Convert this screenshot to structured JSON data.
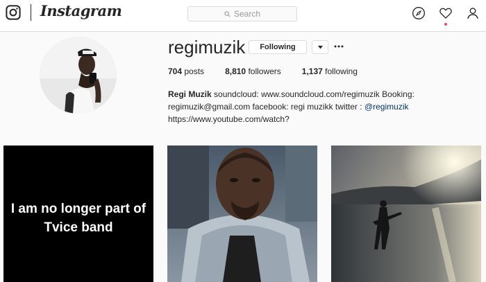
{
  "header": {
    "brand": "Instagram",
    "search_placeholder": "Search",
    "icons": [
      "instagram-camera-icon",
      "compass-icon",
      "heart-icon",
      "user-icon"
    ],
    "notification_dot_color": "#ed4956"
  },
  "profile": {
    "username": "regimuzik",
    "follow_button": "Following",
    "dropdown_icon": "caret-down-icon",
    "more_icon": "ellipsis-icon",
    "stats": {
      "posts_count": "704",
      "posts_label": "posts",
      "followers_count": "8,810",
      "followers_label": "followers",
      "following_count": "1,137",
      "following_label": "following"
    },
    "bio": {
      "full_name": "Regi Muzik",
      "text": "soundcloud: www.soundcloud.com/regimuzik Booking: regimuzik@gmail.com facebook: regi muzikk twitter :",
      "mention": "@regimuzik",
      "link": "https://www.youtube.com/watch?"
    }
  },
  "posts": [
    {
      "caption": "I am no longer part of Tvice band"
    },
    {
      "caption": ""
    },
    {
      "caption": ""
    }
  ],
  "colors": {
    "link": "#003569",
    "border": "#dbdbdb",
    "background": "#fafafa"
  }
}
